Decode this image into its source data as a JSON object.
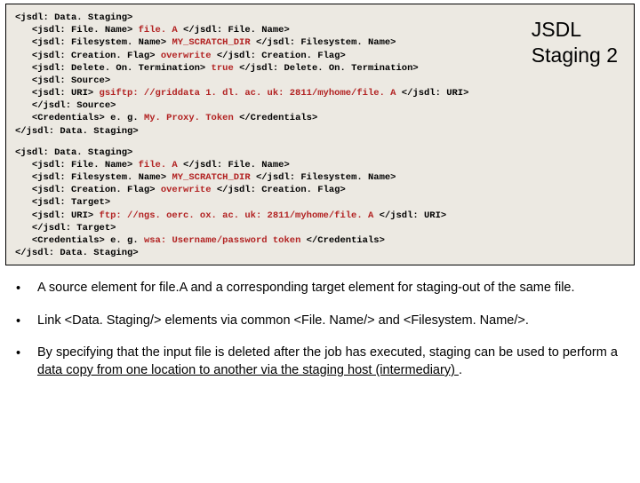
{
  "title_line1": "JSDL",
  "title_line2": "Staging 2",
  "code1": {
    "l1a": "<jsdl: Data. Staging>",
    "l2a": "   <jsdl: File. Name> ",
    "l2b": "file. A",
    "l2c": " </jsdl: File. Name>",
    "l3a": "   <jsdl: Filesystem. Name> ",
    "l3b": "MY_SCRATCH_DIR",
    "l3c": " </jsdl: Filesystem. Name>",
    "l4a": "   <jsdl: Creation. Flag> ",
    "l4b": "overwrite",
    "l4c": " </jsdl: Creation. Flag>",
    "l5a": "   <jsdl: Delete. On. Termination> ",
    "l5b": "true",
    "l5c": " </jsdl: Delete. On. Termination>",
    "l6a": "   <jsdl: Source>",
    "l7a": "   <jsdl: URI> ",
    "l7b": "gsiftp: //griddata 1. dl. ac. uk: 2811/myhome/file. A",
    "l7c": " </jsdl: URI>",
    "l8a": "   </jsdl: Source>",
    "l9a": "   <Credentials> e. g. ",
    "l9b": "My. Proxy. Token",
    "l9c": " </Credentials>",
    "l10a": "</jsdl: Data. Staging>"
  },
  "code2": {
    "l1a": "<jsdl: Data. Staging>",
    "l2a": "   <jsdl: File. Name> ",
    "l2b": "file. A",
    "l2c": " </jsdl: File. Name>",
    "l3a": "   <jsdl: Filesystem. Name> ",
    "l3b": "MY_SCRATCH_DIR",
    "l3c": " </jsdl: Filesystem. Name>",
    "l4a": "   <jsdl: Creation. Flag> ",
    "l4b": "overwrite",
    "l4c": " </jsdl: Creation. Flag>",
    "l5a": "   <jsdl: Target>",
    "l6a": "   <jsdl: URI> ",
    "l6b": "ftp: //ngs. oerc. ox. ac. uk: 2811/myhome/file. A",
    "l6c": " </jsdl: URI>",
    "l7a": "   </jsdl: Target>",
    "l8a": "   <Credentials> e. g. ",
    "l8b": "wsa: Username/password token",
    "l8c": " </Credentials>",
    "l9a": "</jsdl: Data. Staging>"
  },
  "bullets": {
    "dot": "•",
    "b1": "A source element for file.A and a corresponding target element for staging-out of the same file.",
    "b2": "Link <Data. Staging/> elements via common <File. Name/> and <Filesystem. Name/>.",
    "b3a": "By specifying that the input file is deleted after the job has executed, staging can be used to perform a ",
    "b3b": "data copy from one location to another via the staging host (intermediary) ",
    "b3c": "."
  }
}
